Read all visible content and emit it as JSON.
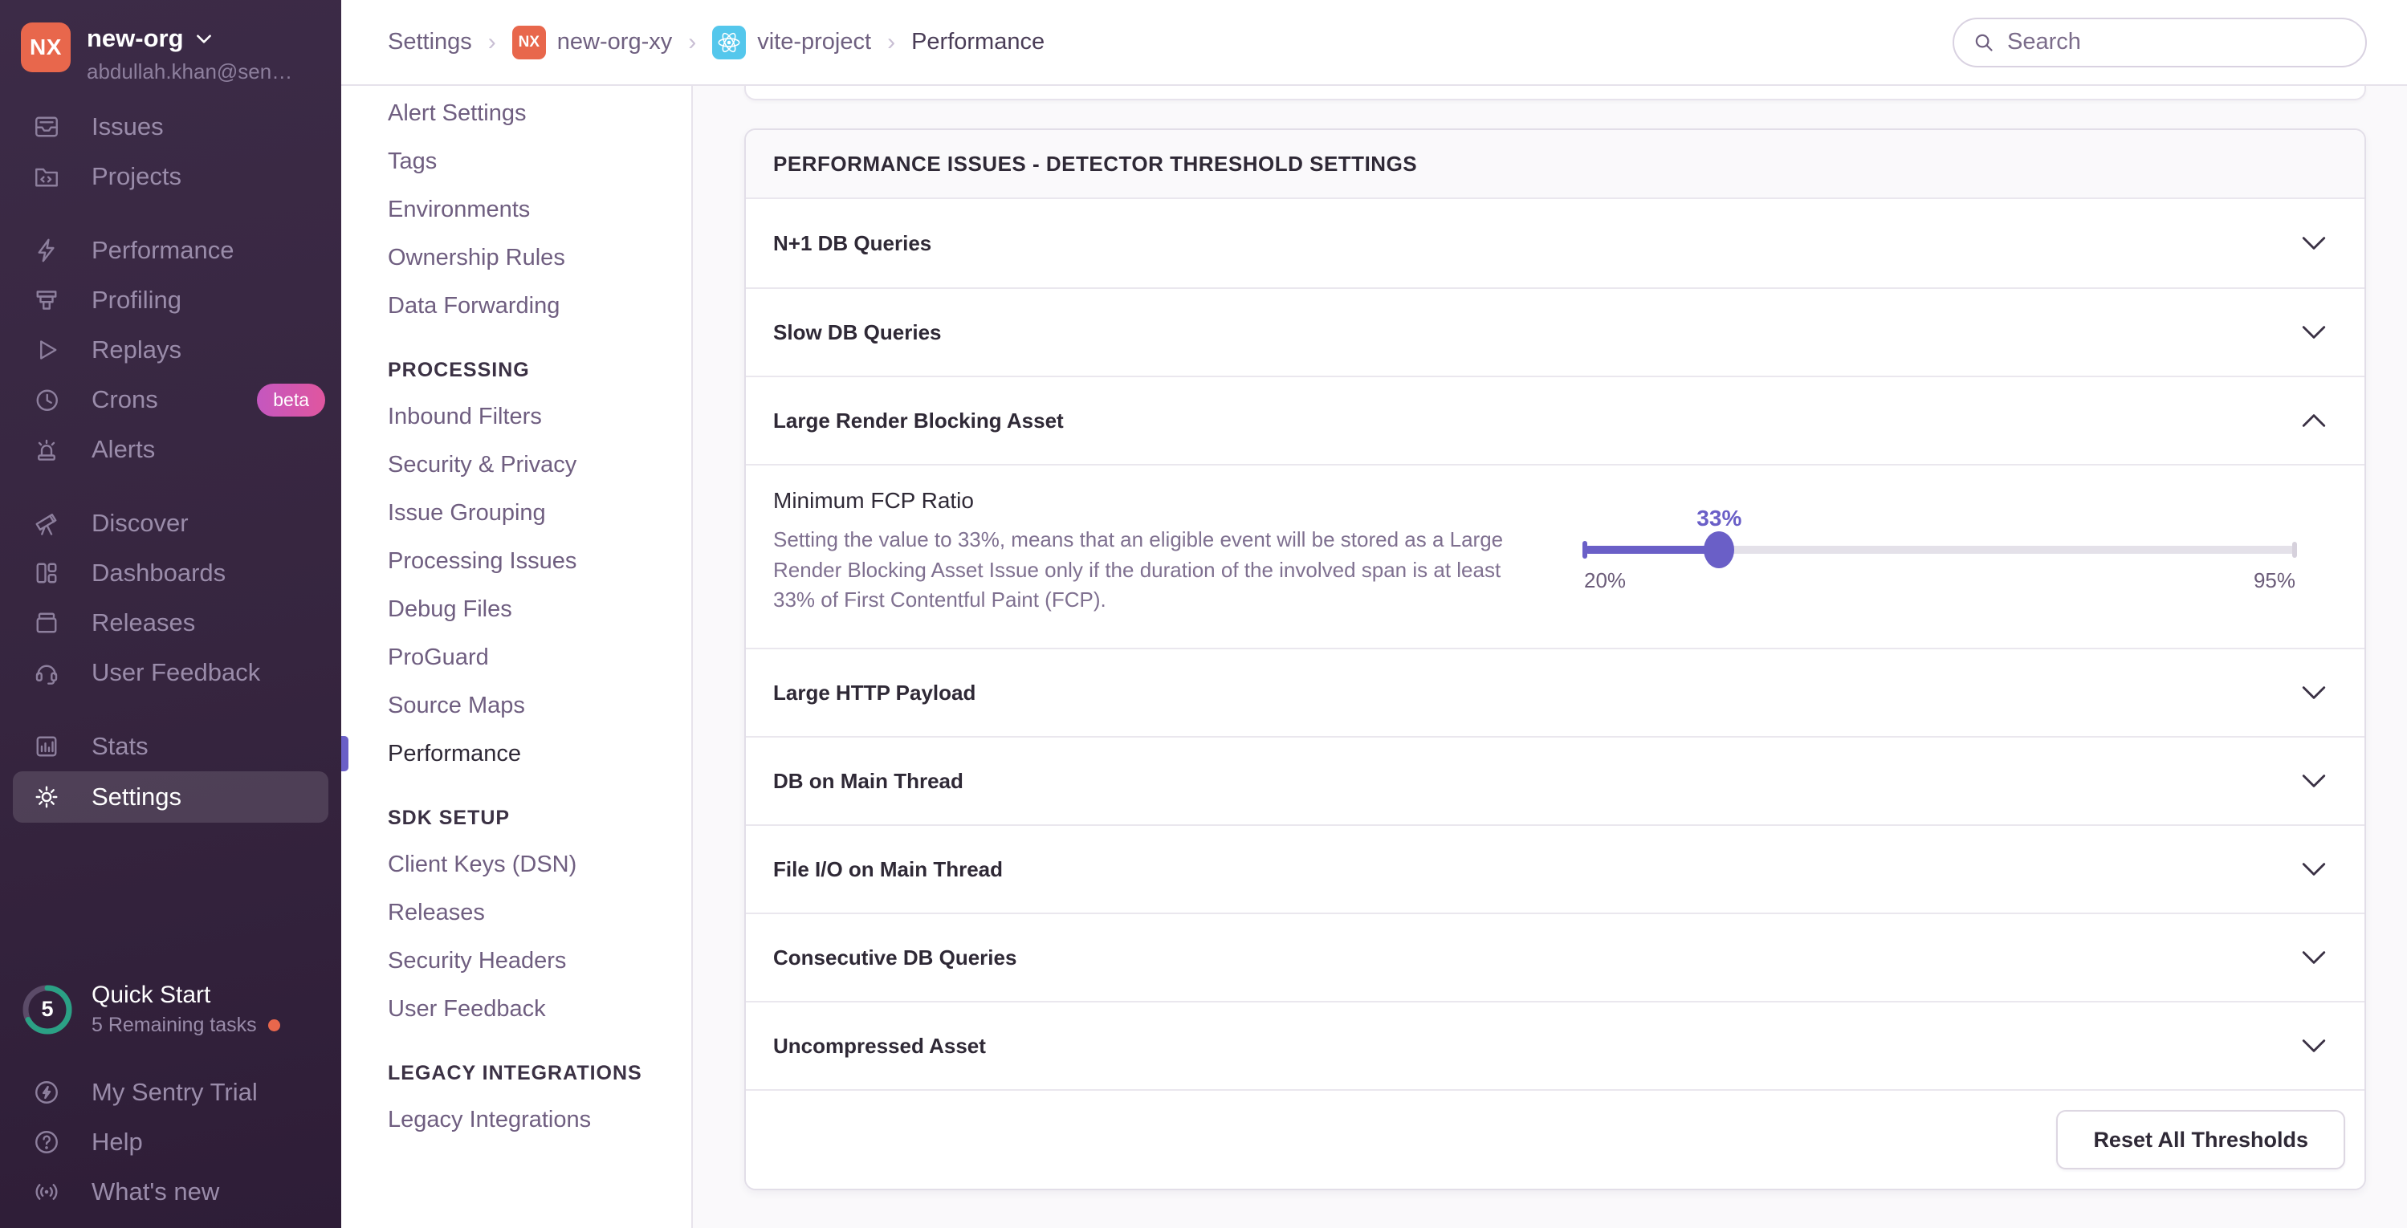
{
  "colors": {
    "accent_purple": "#6A5FC7",
    "sentry_orange": "#E8674C",
    "react_cyan": "#54C7EC",
    "progress_teal": "#2BA185",
    "beta_gradient": [
      "#c457bf",
      "#e0569f"
    ]
  },
  "sidebar": {
    "org_name": "new-org",
    "org_email": "abdullah.khan@sen…",
    "org_initials": "NX",
    "nav": {
      "issues": "Issues",
      "projects": "Projects",
      "performance": "Performance",
      "profiling": "Profiling",
      "replays": "Replays",
      "crons": "Crons",
      "crons_badge": "beta",
      "alerts": "Alerts",
      "discover": "Discover",
      "dashboards": "Dashboards",
      "releases": "Releases",
      "user_feedback": "User Feedback",
      "stats": "Stats",
      "settings": "Settings"
    },
    "quick_start": {
      "count": "5",
      "title": "Quick Start",
      "subtitle": "5 Remaining tasks"
    },
    "footer": {
      "trial": "My Sentry Trial",
      "help": "Help",
      "whats_new": "What's new"
    }
  },
  "header": {
    "breadcrumb": {
      "settings": "Settings",
      "org_initials": "NX",
      "org": "new-org-xy",
      "project": "vite-project",
      "page": "Performance"
    },
    "search_placeholder": "Search"
  },
  "settings_nav": {
    "items_top": [
      "Alert Settings",
      "Tags",
      "Environments",
      "Ownership Rules",
      "Data Forwarding"
    ],
    "processing_title": "PROCESSING",
    "processing_items": [
      "Inbound Filters",
      "Security & Privacy",
      "Issue Grouping",
      "Processing Issues",
      "Debug Files",
      "ProGuard",
      "Source Maps",
      "Performance"
    ],
    "sdk_title": "SDK SETUP",
    "sdk_items": [
      "Client Keys (DSN)",
      "Releases",
      "Security Headers",
      "User Feedback"
    ],
    "legacy_title": "LEGACY INTEGRATIONS",
    "legacy_items": [
      "Legacy Integrations"
    ],
    "active_item": "Performance"
  },
  "main": {
    "panel_title": "PERFORMANCE ISSUES - DETECTOR THRESHOLD SETTINGS",
    "rows": [
      {
        "label": "N+1 DB Queries",
        "expanded": false
      },
      {
        "label": "Slow DB Queries",
        "expanded": false
      },
      {
        "label": "Large Render Blocking Asset",
        "expanded": true
      },
      {
        "label": "Large HTTP Payload",
        "expanded": false
      },
      {
        "label": "DB on Main Thread",
        "expanded": false
      },
      {
        "label": "File I/O on Main Thread",
        "expanded": false
      },
      {
        "label": "Consecutive DB Queries",
        "expanded": false
      },
      {
        "label": "Uncompressed Asset",
        "expanded": false
      }
    ],
    "fcp_setting": {
      "label": "Minimum FCP Ratio",
      "description": "Setting the value to 33%, means that an eligible event will be stored as a Large Render Blocking Asset Issue only if the duration of the involved span is at least 33% of First Contentful Paint (FCP).",
      "value": "33%",
      "min": "20%",
      "max": "95%"
    },
    "reset_button": "Reset All Thresholds"
  }
}
